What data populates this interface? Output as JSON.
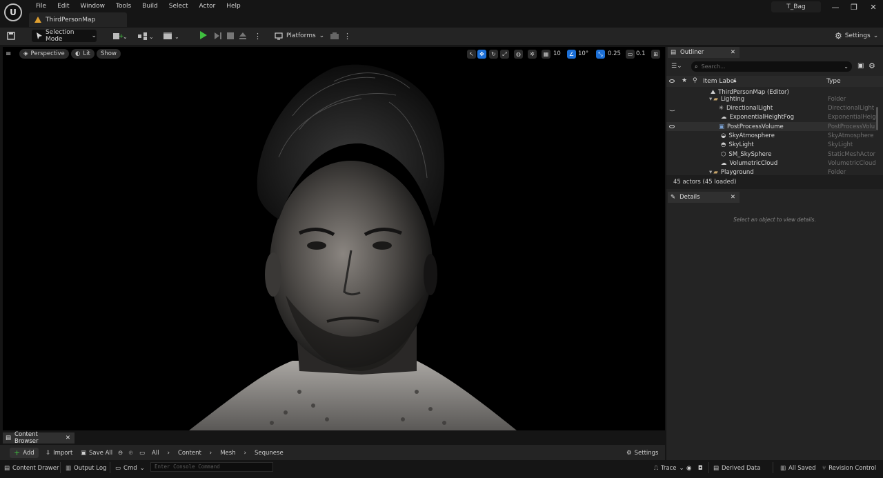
{
  "menu": [
    "File",
    "Edit",
    "Window",
    "Tools",
    "Build",
    "Select",
    "Actor",
    "Help"
  ],
  "doc_tab": "ThirdPersonMap",
  "project_name": "T_Bag",
  "window_controls": [
    "—",
    "❐",
    "✕"
  ],
  "toolbar": {
    "selection_mode": "Selection Mode",
    "platforms": "Platforms",
    "settings": "Settings"
  },
  "viewport": {
    "perspective": "Perspective",
    "lit": "Lit",
    "show": "Show",
    "grid_snap": "10",
    "rotation_snap": "10°",
    "scale_snap": "0.25",
    "camera_speed": "0.1"
  },
  "outliner": {
    "tab": "Outliner",
    "search_placeholder": "Search...",
    "col_label": "Item Label",
    "col_type": "Type",
    "rows": [
      {
        "label": "ThirdPersonMap (Editor)",
        "type": ""
      },
      {
        "label": "Lighting",
        "type": "Folder"
      },
      {
        "label": "DirectionalLight",
        "type": "DirectionalLight"
      },
      {
        "label": "ExponentialHeightFog",
        "type": "ExponentialHeigh"
      },
      {
        "label": "PostProcessVolume",
        "type": "PostProcessVolu"
      },
      {
        "label": "SkyAtmosphere",
        "type": "SkyAtmosphere"
      },
      {
        "label": "SkyLight",
        "type": "SkyLight"
      },
      {
        "label": "SM_SkySphere",
        "type": "StaticMeshActor"
      },
      {
        "label": "VolumetricCloud",
        "type": "VolumetricCloud"
      },
      {
        "label": "Playground",
        "type": "Folder"
      }
    ],
    "status": "45 actors (45 loaded)"
  },
  "details": {
    "tab": "Details",
    "empty": "Select an object to view details."
  },
  "content_browser": {
    "tab": "Content Browser",
    "add": "Add",
    "import": "Import",
    "save_all": "Save All",
    "path": [
      "All",
      "Content",
      "Mesh",
      "Sequnese"
    ],
    "settings": "Settings"
  },
  "bottom_bar": {
    "content_drawer": "Content Drawer",
    "output_log": "Output Log",
    "cmd": "Cmd",
    "console_placeholder": "Enter Console Command",
    "trace": "Trace",
    "derived_data": "Derived Data",
    "all_saved": "All Saved",
    "revision_control": "Revision Control"
  },
  "colors": {
    "accent_blue": "#1c6fd6",
    "play_green": "#3fbf3f",
    "folder_tan": "#c9a66b"
  }
}
